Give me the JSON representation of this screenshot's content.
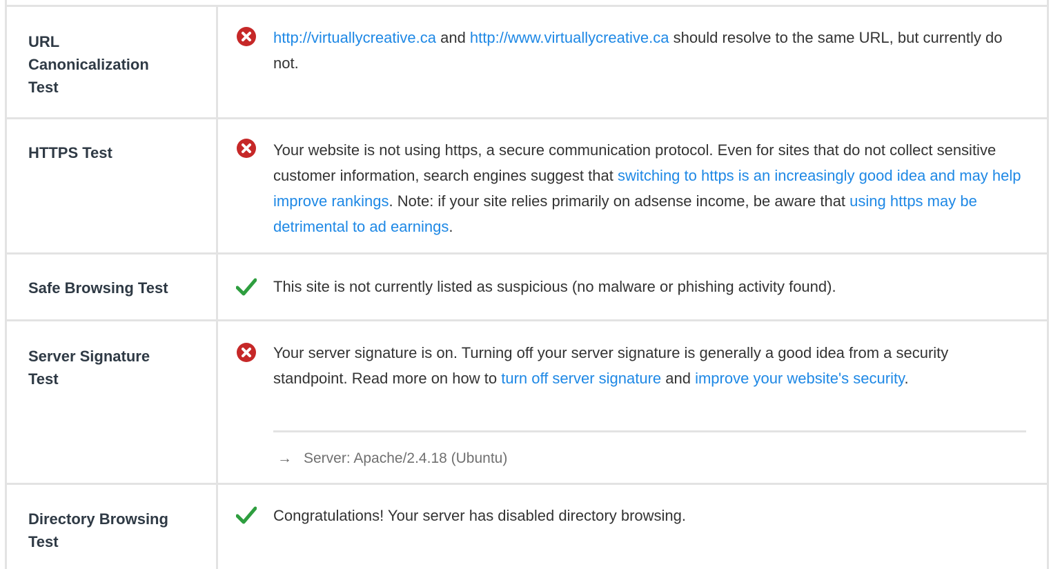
{
  "colors": {
    "border": "#e3e3e3",
    "link": "#1e88e5",
    "fail": "#c62828",
    "pass": "#2e9e3f"
  },
  "tests": [
    {
      "name": "URL Canonicalization Test",
      "status": "fail",
      "icon": "fail-x-circle-icon",
      "link_1": "http://virtuallycreative.ca",
      "text_1": " and ",
      "link_2": "http://www.virtuallycreative.ca",
      "text_2": " should resolve to the same URL, but currently do not."
    },
    {
      "name": "HTTPS Test",
      "status": "fail",
      "icon": "fail-x-circle-icon",
      "text_1": "Your website is not using https, a secure communication protocol. Even for sites that do not collect sensitive customer information, search engines suggest that ",
      "link_1": "switching to https is an increasingly good idea and may help improve rankings",
      "text_2": ". Note: if your site relies primarily on adsense income, be aware that ",
      "link_2": "using https may be detrimental to ad earnings",
      "text_3": "."
    },
    {
      "name": "Safe Browsing Test",
      "status": "pass",
      "icon": "pass-checkmark-icon",
      "text_1": "This site is not currently listed as suspicious (no malware or phishing activity found)."
    },
    {
      "name": "Server Signature Test",
      "status": "fail",
      "icon": "fail-x-circle-icon",
      "text_1": "Your server signature is on. Turning off your server signature is generally a good idea from a security standpoint. Read more on how to ",
      "link_1": "turn off server signature",
      "text_2": " and ",
      "link_2": "improve your website's security",
      "text_3": ".",
      "detail_arrow": "→",
      "detail": "Server: Apache/2.4.18 (Ubuntu)"
    },
    {
      "name": "Directory Browsing Test",
      "status": "pass",
      "icon": "pass-checkmark-icon",
      "text_1": "Congratulations! Your server has disabled directory browsing."
    }
  ]
}
